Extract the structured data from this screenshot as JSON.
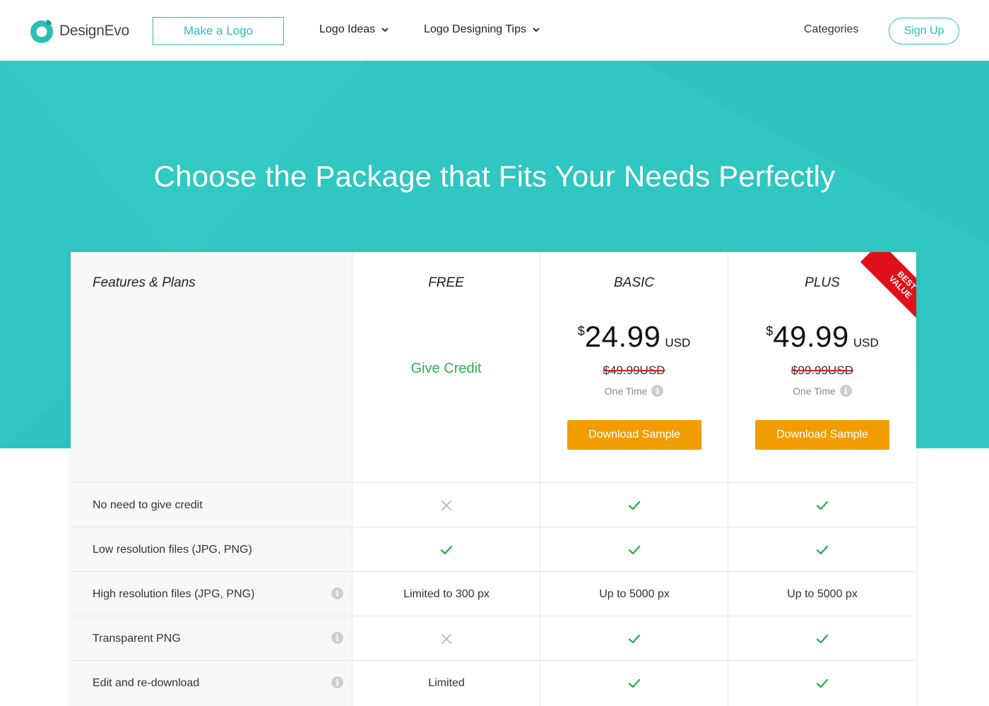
{
  "header": {
    "brand": "DesignEvo",
    "make_logo": "Make a Logo",
    "nav": {
      "logo_ideas": "Logo Ideas",
      "logo_tips": "Logo Designing Tips",
      "categories": "Categories"
    },
    "sign_up": "Sign Up"
  },
  "hero": {
    "title": "Choose the Package that Fits Your Needs Perfectly"
  },
  "table": {
    "features_heading": "Features & Plans",
    "plans": {
      "free": {
        "name": "FREE",
        "credit": "Give Credit"
      },
      "basic": {
        "name": "BASIC",
        "currency": "$",
        "price": "24.99",
        "unit": "USD",
        "old_price": "$49.99USD",
        "billing": "One Time",
        "download": "Download Sample"
      },
      "plus": {
        "name": "PLUS",
        "currency": "$",
        "price": "49.99",
        "unit": "USD",
        "old_price": "$99.99USD",
        "billing": "One Time",
        "download": "Download Sample",
        "ribbon": [
          "BEST",
          "VALUE"
        ]
      }
    },
    "rows": [
      {
        "feature": "No need to give credit",
        "info": false,
        "free": "cross",
        "basic": "check",
        "plus": "check"
      },
      {
        "feature": "Low resolution files (JPG, PNG)",
        "info": false,
        "free": "check",
        "basic": "check",
        "plus": "check"
      },
      {
        "feature": "High resolution files (JPG, PNG)",
        "info": true,
        "free": "Limited to 300 px",
        "basic": "Up to 5000 px",
        "plus": "Up to 5000 px"
      },
      {
        "feature": "Transparent PNG",
        "info": true,
        "free": "cross",
        "basic": "check",
        "plus": "check"
      },
      {
        "feature": "Edit and re-download",
        "info": true,
        "free": "Limited",
        "basic": "check",
        "plus": "check"
      }
    ]
  },
  "colors": {
    "accent": "#29bfb8",
    "hero_bg": "#30c6c1",
    "credit_green": "#2db04b",
    "check_green": "#2db04b",
    "button_orange": "#f19d00",
    "ribbon_red": "#e0101a"
  },
  "icons": {
    "check": "check-icon",
    "cross": "cross-icon",
    "info": "info-icon",
    "chevron": "chevron-down-icon"
  }
}
